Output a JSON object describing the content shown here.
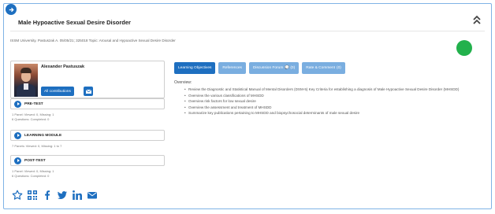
{
  "course": {
    "title": "Male Hypoactive Sexual Desire Disorder",
    "citation": "ISSM University. Pastuszak A. 05/05/21; 325018 Topic: Arousal and Hypoactive Sexual Desire Disorder",
    "status_color": "#22b14c"
  },
  "author": {
    "name": "Alexander Pastuszak",
    "contributions_label": "All contributions"
  },
  "sections": [
    {
      "label": "PRE-TEST",
      "stats": [
        "1 Panel: Viewed: 0, Missing: 1",
        "6 Questions: Completed: 0"
      ]
    },
    {
      "label": "LEARNING MODULE",
      "stats": [
        "7 Panels: Viewed: 0, Missing: 1 to 7"
      ]
    },
    {
      "label": "POST-TEST",
      "stats": [
        "1 Panel: Viewed: 0, Missing: 1",
        "6 Questions: Completed: 0"
      ]
    }
  ],
  "tabs": [
    {
      "label": "Learning Objectives",
      "active": true
    },
    {
      "label": "References",
      "active": false
    },
    {
      "label": "Discussion Forum",
      "suffix": "(0)",
      "active": false
    },
    {
      "label": "Rate & Comment",
      "suffix": "(0)",
      "active": false
    }
  ],
  "overview": {
    "label": "Overview:",
    "items": [
      "Review the Diagnostic and Statistical Manual of Mental Disorders (DSM-5) Key Criteria for establishing a diagnosis of Male Hypoactive Sexual Desire Disorder (MHSDD)",
      "Overview the various classifications of MHSDD",
      "Overview risk factors for low sexual desire",
      "Overview the assessment and treatment of MHSDD",
      "Summarize key publications pertaining to MHSDD and biopsychosocial determinants of male sexual desire"
    ]
  },
  "colors": {
    "primary": "#1e6fc0",
    "tab_inactive": "#7aaee0",
    "border": "#7fb3e6"
  },
  "icons": [
    "collapse-up-icon",
    "star-icon",
    "qr-code-icon",
    "facebook-icon",
    "twitter-icon",
    "linkedin-icon",
    "email-icon",
    "play-icon",
    "envelope-icon",
    "arrow-right-icon"
  ]
}
